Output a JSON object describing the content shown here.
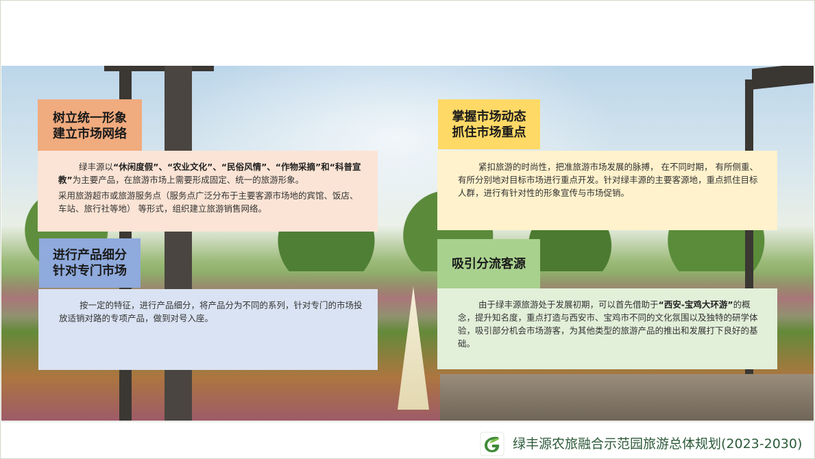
{
  "panels": [
    {
      "title_line1": "树立统一形象",
      "title_line2": "建立市场网络",
      "color": "#f0ab7e",
      "para1_a": "绿丰源以",
      "para1_b": "“休闲度假”、“农业文化”、“民俗风情”、“作物采摘”和“科普宣教”",
      "para1_c": "为主要产品，在旅游市场上需要形成固定、统一的旅游形象。",
      "para2": "采用旅游超市或旅游服务点（服务点广泛分布于主要客源市场地的宾馆、饭店、车站、旅行社等地） 等形式，组织建立旅游销售网络。"
    },
    {
      "title_line1": "掌握市场动态",
      "title_line2": "抓住市场重点",
      "color": "#ffd966",
      "para1": "紧扣旅游的时尚性，把准旅游市场发展的脉搏， 在不同时期， 有所侧重、有所分别地对目标市场进行重点开发。针对绿丰源的主要客源地，重点抓住目标人群，进行有针对性的形象宣传与市场促销。"
    },
    {
      "title_line1": "进行产品细分",
      "title_line2": "针对专门市场",
      "color": "#8faadc",
      "para1": "按一定的特征，进行产品细分，将产品分为不同的系列，针对专门的市场投放适销对路的专项产品，做到对号入座。"
    },
    {
      "title_line1": "吸引分流客源",
      "color": "#a9d18e",
      "para1_a": "由于绿丰源旅游处于发展初期，可以首先借助于",
      "para1_b": "“西安-宝鸡大环游”",
      "para1_c": "的概念，提升知名度，重点打造与西安市、宝鸡市不同的文化氛围以及独特的研学体验，吸引部分机会市场游客，为其他类型的旅游产品的推出和发展打下良好的基础。"
    }
  ],
  "footer": {
    "title": "绿丰源农旅融合示范园旅游总体规划(2023-2030)",
    "logo_icon": "leaf-g-logo-icon",
    "brand_color": "#2d5a3a"
  }
}
